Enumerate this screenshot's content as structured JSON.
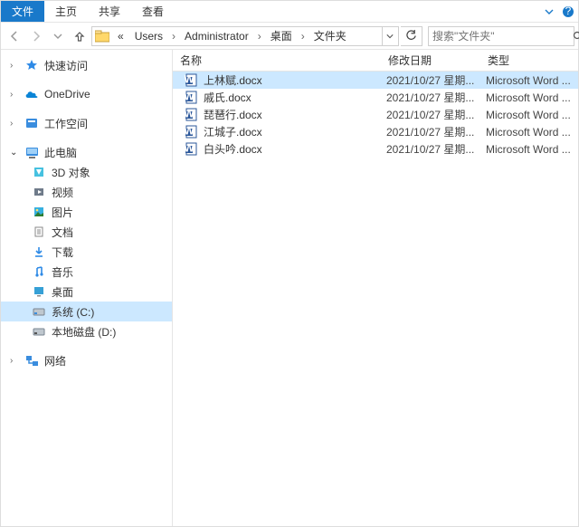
{
  "ribbon": {
    "file": "文件",
    "home": "主页",
    "share": "共享",
    "view": "查看"
  },
  "nav": {
    "crumbs": [
      "«",
      "Users",
      "Administrator",
      "桌面",
      "文件夹"
    ],
    "search_placeholder": "搜索\"文件夹\""
  },
  "sidebar": {
    "quick": "快速访问",
    "onedrive": "OneDrive",
    "workspace": "工作空间",
    "thispc": "此电脑",
    "items_pc": [
      "3D 对象",
      "视频",
      "图片",
      "文档",
      "下载",
      "音乐",
      "桌面",
      "系统 (C:)",
      "本地磁盘 (D:)"
    ],
    "network": "网络"
  },
  "columns": {
    "name": "名称",
    "date": "修改日期",
    "type": "类型"
  },
  "files": [
    {
      "name": "上林赋.docx",
      "date": "2021/10/27 星期...",
      "type": "Microsoft Word ...",
      "selected": true
    },
    {
      "name": "戚氏.docx",
      "date": "2021/10/27 星期...",
      "type": "Microsoft Word ..."
    },
    {
      "name": "琵琶行.docx",
      "date": "2021/10/27 星期...",
      "type": "Microsoft Word ..."
    },
    {
      "name": "江城子.docx",
      "date": "2021/10/27 星期...",
      "type": "Microsoft Word ..."
    },
    {
      "name": "白头吟.docx",
      "date": "2021/10/27 星期...",
      "type": "Microsoft Word ..."
    }
  ]
}
